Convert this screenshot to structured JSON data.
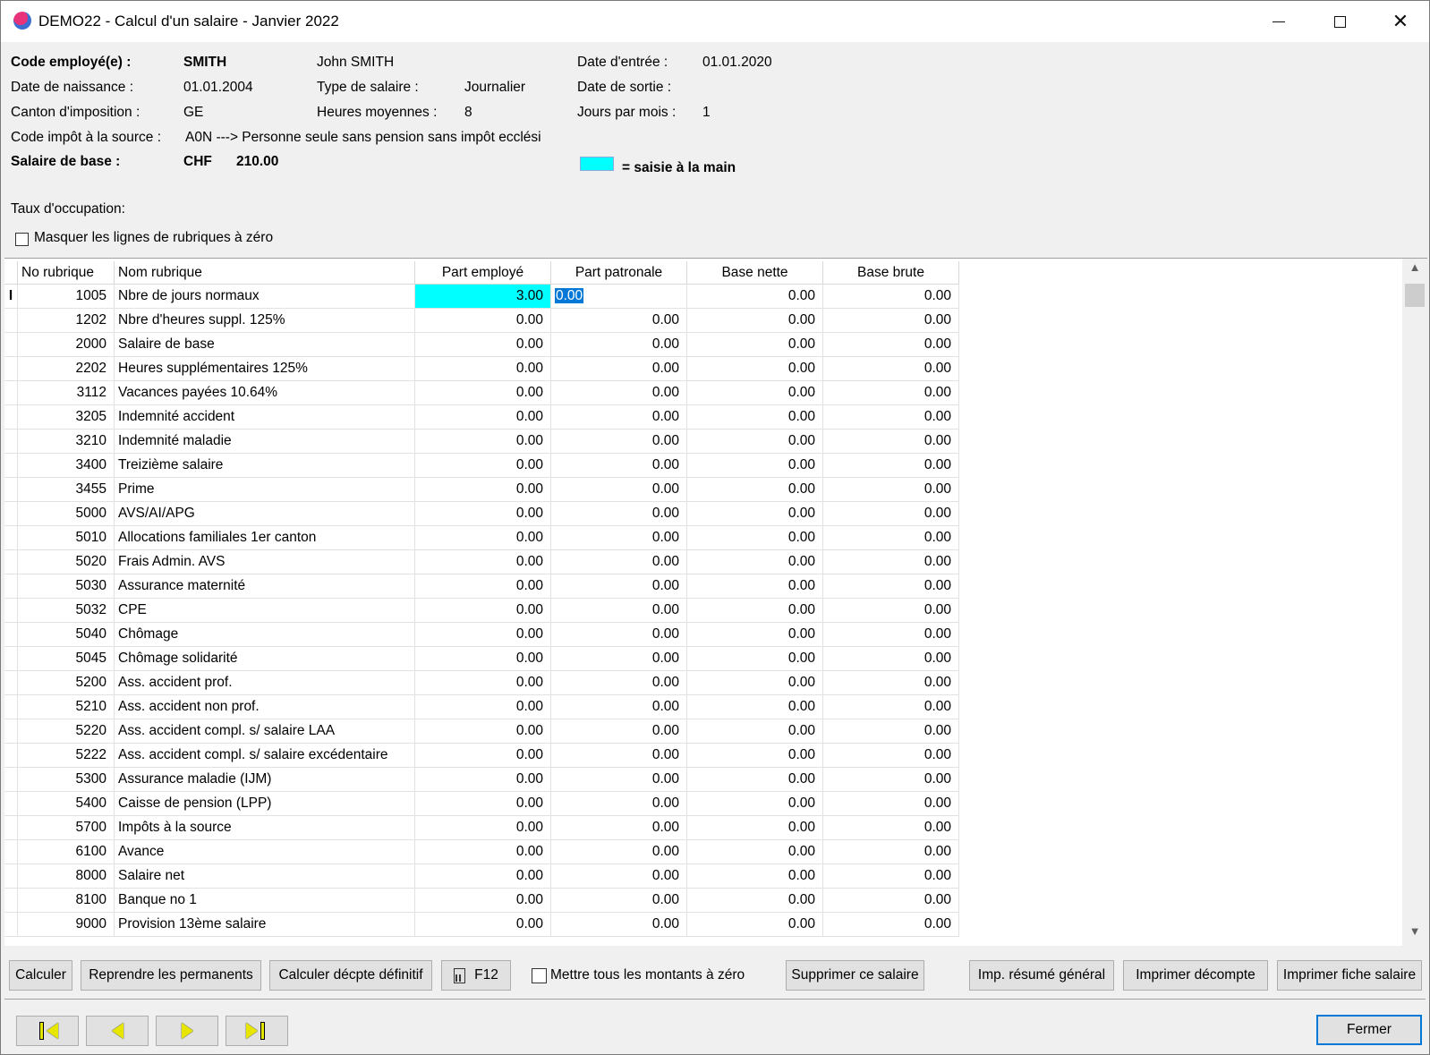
{
  "window": {
    "title": "DEMO22 - Calcul d'un salaire - Janvier 2022"
  },
  "header": {
    "code_label": "Code employé(e) :",
    "code_value": "SMITH",
    "full_name": "John SMITH",
    "entry_label": "Date d'entrée :",
    "entry_value": "01.01.2020",
    "birth_label": "Date de naissance :",
    "birth_value": "01.01.2004",
    "salary_type_label": "Type de salaire :",
    "salary_type_value": "Journalier",
    "exit_label": "Date de sortie :",
    "exit_value": "",
    "canton_label": "Canton d'imposition :",
    "canton_value": "GE",
    "avg_hours_label": "Heures moyennes :",
    "avg_hours_value": "8",
    "days_label": "Jours par mois :",
    "days_value": "1",
    "tax_code_label": "Code impôt à la source :",
    "tax_code_value": "A0N ---> Personne seule sans pension sans impôt ecclési",
    "base_label": "Salaire de  base :",
    "currency": "CHF",
    "base_value": "210.00",
    "legend_text": "= saisie à la main",
    "legend_color": "#00ffff",
    "occupation_label": "Taux d'occupation:",
    "hide_zero_label": "Masquer les lignes de rubriques à zéro"
  },
  "grid": {
    "columns": [
      "No rubrique",
      "Nom rubrique",
      "Part employé",
      "Part patronale",
      "Base nette",
      "Base brute"
    ],
    "rows": [
      {
        "no": "1005",
        "name": "Nbre de jours normaux",
        "emp": "3.00",
        "pat": "0.00",
        "net": "0.00",
        "brut": "0.00"
      },
      {
        "no": "1202",
        "name": "Nbre d'heures suppl. 125%",
        "emp": "0.00",
        "pat": "0.00",
        "net": "0.00",
        "brut": "0.00"
      },
      {
        "no": "2000",
        "name": "Salaire de base",
        "emp": "0.00",
        "pat": "0.00",
        "net": "0.00",
        "brut": "0.00"
      },
      {
        "no": "2202",
        "name": "Heures supplémentaires 125%",
        "emp": "0.00",
        "pat": "0.00",
        "net": "0.00",
        "brut": "0.00"
      },
      {
        "no": "3112",
        "name": "Vacances payées 10.64%",
        "emp": "0.00",
        "pat": "0.00",
        "net": "0.00",
        "brut": "0.00"
      },
      {
        "no": "3205",
        "name": "Indemnité accident",
        "emp": "0.00",
        "pat": "0.00",
        "net": "0.00",
        "brut": "0.00"
      },
      {
        "no": "3210",
        "name": "Indemnité maladie",
        "emp": "0.00",
        "pat": "0.00",
        "net": "0.00",
        "brut": "0.00"
      },
      {
        "no": "3400",
        "name": "Treizième salaire",
        "emp": "0.00",
        "pat": "0.00",
        "net": "0.00",
        "brut": "0.00"
      },
      {
        "no": "3455",
        "name": "Prime",
        "emp": "0.00",
        "pat": "0.00",
        "net": "0.00",
        "brut": "0.00"
      },
      {
        "no": "5000",
        "name": "AVS/AI/APG",
        "emp": "0.00",
        "pat": "0.00",
        "net": "0.00",
        "brut": "0.00"
      },
      {
        "no": "5010",
        "name": "Allocations familiales 1er canton",
        "emp": "0.00",
        "pat": "0.00",
        "net": "0.00",
        "brut": "0.00"
      },
      {
        "no": "5020",
        "name": "Frais Admin. AVS",
        "emp": "0.00",
        "pat": "0.00",
        "net": "0.00",
        "brut": "0.00"
      },
      {
        "no": "5030",
        "name": "Assurance maternité",
        "emp": "0.00",
        "pat": "0.00",
        "net": "0.00",
        "brut": "0.00"
      },
      {
        "no": "5032",
        "name": "CPE",
        "emp": "0.00",
        "pat": "0.00",
        "net": "0.00",
        "brut": "0.00"
      },
      {
        "no": "5040",
        "name": "Chômage",
        "emp": "0.00",
        "pat": "0.00",
        "net": "0.00",
        "brut": "0.00"
      },
      {
        "no": "5045",
        "name": "Chômage solidarité",
        "emp": "0.00",
        "pat": "0.00",
        "net": "0.00",
        "brut": "0.00"
      },
      {
        "no": "5200",
        "name": "Ass. accident prof.",
        "emp": "0.00",
        "pat": "0.00",
        "net": "0.00",
        "brut": "0.00"
      },
      {
        "no": "5210",
        "name": "Ass. accident non prof.",
        "emp": "0.00",
        "pat": "0.00",
        "net": "0.00",
        "brut": "0.00"
      },
      {
        "no": "5220",
        "name": "Ass. accident compl. s/ salaire LAA",
        "emp": "0.00",
        "pat": "0.00",
        "net": "0.00",
        "brut": "0.00"
      },
      {
        "no": "5222",
        "name": "Ass. accident compl. s/ salaire excédentaire",
        "emp": "0.00",
        "pat": "0.00",
        "net": "0.00",
        "brut": "0.00"
      },
      {
        "no": "5300",
        "name": "Assurance maladie (IJM)",
        "emp": "0.00",
        "pat": "0.00",
        "net": "0.00",
        "brut": "0.00"
      },
      {
        "no": "5400",
        "name": "Caisse de pension (LPP)",
        "emp": "0.00",
        "pat": "0.00",
        "net": "0.00",
        "brut": "0.00"
      },
      {
        "no": "5700",
        "name": "Impôts à la source",
        "emp": "0.00",
        "pat": "0.00",
        "net": "0.00",
        "brut": "0.00"
      },
      {
        "no": "6100",
        "name": "Avance",
        "emp": "0.00",
        "pat": "0.00",
        "net": "0.00",
        "brut": "0.00"
      },
      {
        "no": "8000",
        "name": "Salaire net",
        "emp": "0.00",
        "pat": "0.00",
        "net": "0.00",
        "brut": "0.00"
      },
      {
        "no": "8100",
        "name": "Banque no 1",
        "emp": "0.00",
        "pat": "0.00",
        "net": "0.00",
        "brut": "0.00"
      },
      {
        "no": "9000",
        "name": "Provision 13ème salaire",
        "emp": "0.00",
        "pat": "0.00",
        "net": "0.00",
        "brut": "0.00"
      }
    ]
  },
  "actions": {
    "calculer": "Calculer",
    "reprendre": "Reprendre les permanents",
    "definitif": "Calculer décpte définitif",
    "f12": "F12",
    "zero_label": "Mettre tous les montants à zéro",
    "supprimer": "Supprimer ce salaire",
    "resume": "Imp. résumé général",
    "decompte": "Imprimer  décompte",
    "fiche": "Imprimer fiche salaire",
    "fermer": "Fermer"
  }
}
